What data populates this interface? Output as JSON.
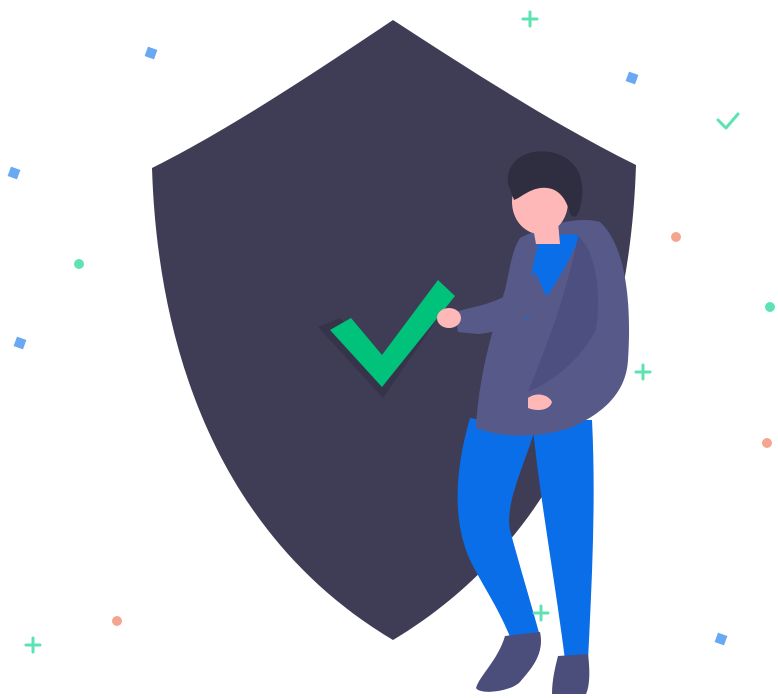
{
  "illustration": {
    "subject": "security-shield-approved",
    "icons": [
      "shield-icon",
      "checkmark-icon",
      "person-figure"
    ],
    "colors": {
      "background": "#ffffff",
      "shield": "#3f3d56",
      "check": "#00c27a",
      "check_shadow": "#2f2e41",
      "jacket": "#575a89",
      "jacket_dark": "#45477a",
      "shirt": "#0a6ee8",
      "pants": "#0a6ee8",
      "shoes": "#4b4d7a",
      "skin": "#ffb8b8",
      "hair": "#2f2e41",
      "confetti_blue": "#69a8f3",
      "confetti_green": "#5de3b1",
      "confetti_salmon": "#f4a58f"
    }
  }
}
